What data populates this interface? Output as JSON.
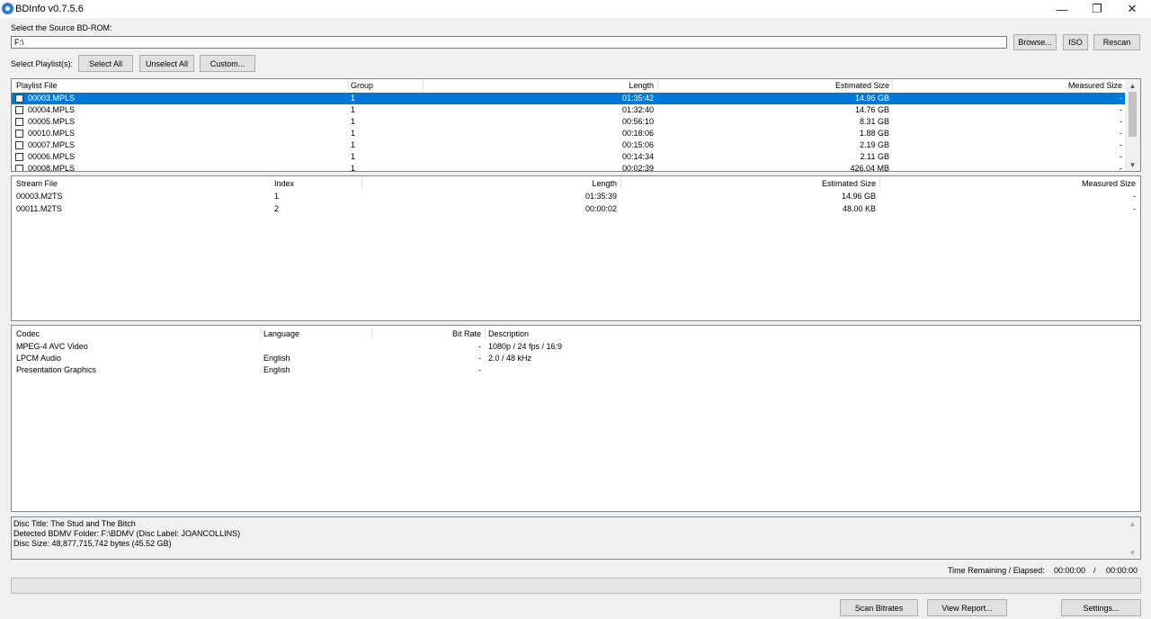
{
  "window": {
    "title": "BDInfo v0.7.5.6",
    "minimize": "—",
    "maximize": "❐",
    "close": "✕"
  },
  "source": {
    "label": "Select the Source BD-ROM:",
    "path": "F:\\",
    "browse": "Browse...",
    "iso": "ISO",
    "rescan": "Rescan"
  },
  "playlists_bar": {
    "label": "Select Playlist(s):",
    "select_all": "Select All",
    "unselect_all": "Unselect All",
    "custom": "Custom..."
  },
  "playlist_table": {
    "headers": [
      "Playlist File",
      "Group",
      "Length",
      "Estimated Size",
      "Measured Size"
    ],
    "rows": [
      {
        "file": "00003.MPLS",
        "group": "1",
        "length": "01:35:42",
        "est": "14.96 GB",
        "meas": "-"
      },
      {
        "file": "00004.MPLS",
        "group": "1",
        "length": "01:32:40",
        "est": "14.76 GB",
        "meas": "-"
      },
      {
        "file": "00005.MPLS",
        "group": "1",
        "length": "00:56:10",
        "est": "8.31 GB",
        "meas": "-"
      },
      {
        "file": "00010.MPLS",
        "group": "1",
        "length": "00:18:06",
        "est": "1.88 GB",
        "meas": "-"
      },
      {
        "file": "00007.MPLS",
        "group": "1",
        "length": "00:15:06",
        "est": "2.19 GB",
        "meas": "-"
      },
      {
        "file": "00006.MPLS",
        "group": "1",
        "length": "00:14:34",
        "est": "2.11 GB",
        "meas": "-"
      },
      {
        "file": "00008.MPLS",
        "group": "1",
        "length": "00:02:39",
        "est": "426.04 MB",
        "meas": "-"
      }
    ]
  },
  "stream_table": {
    "headers": [
      "Stream File",
      "Index",
      "Length",
      "Estimated Size",
      "Measured Size"
    ],
    "rows": [
      {
        "file": "00003.M2TS",
        "index": "1",
        "length": "01:35:39",
        "est": "14.96 GB",
        "meas": "-"
      },
      {
        "file": "00011.M2TS",
        "index": "2",
        "length": "00:00:02",
        "est": "48.00 KB",
        "meas": "-"
      }
    ]
  },
  "codec_table": {
    "headers": [
      "Codec",
      "Language",
      "Bit Rate",
      "Description"
    ],
    "rows": [
      {
        "codec": "MPEG-4 AVC Video",
        "lang": "",
        "bitrate": "-",
        "desc": "1080p / 24 fps / 16:9"
      },
      {
        "codec": "LPCM Audio",
        "lang": "English",
        "bitrate": "-",
        "desc": "2.0 / 48 kHz"
      },
      {
        "codec": "Presentation Graphics",
        "lang": "English",
        "bitrate": "-",
        "desc": ""
      }
    ]
  },
  "disc_info": {
    "lines": [
      "Disc Title: The Stud and The Bitch",
      "Detected BDMV Folder: F:\\BDMV (Disc Label: JOANCOLLINS)",
      "Disc Size: 48,877,715,742 bytes (45.52 GB)"
    ]
  },
  "status": {
    "time_label": "Time Remaining / Elapsed:",
    "remaining": "00:00:00",
    "slash": "/",
    "elapsed": "00:00:00",
    "progress": 0
  },
  "bottom_buttons": {
    "scan": "Scan Bitrates",
    "report": "View Report...",
    "settings": "Settings..."
  },
  "scroll_arrows": {
    "up": "▲",
    "down": "▼"
  }
}
